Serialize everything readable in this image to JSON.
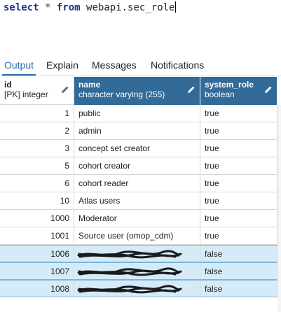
{
  "query": {
    "kw_select": "select",
    "star": "*",
    "kw_from": "from",
    "table": "webapi.sec_role"
  },
  "tabs": [
    {
      "label": "Output",
      "active": true
    },
    {
      "label": "Explain"
    },
    {
      "label": "Messages"
    },
    {
      "label": "Notifications"
    }
  ],
  "columns": [
    {
      "name": "id",
      "type": "[PK] integer"
    },
    {
      "name": "name",
      "type": "character varying (255)"
    },
    {
      "name": "system_role",
      "type": "boolean"
    }
  ],
  "rows": [
    {
      "id": "1",
      "name": "public",
      "system_role": "true"
    },
    {
      "id": "2",
      "name": "admin",
      "system_role": "true"
    },
    {
      "id": "3",
      "name": "concept set creator",
      "system_role": "true"
    },
    {
      "id": "5",
      "name": "cohort creator",
      "system_role": "true"
    },
    {
      "id": "6",
      "name": "cohort reader",
      "system_role": "true"
    },
    {
      "id": "10",
      "name": "Atlas users",
      "system_role": "true"
    },
    {
      "id": "1000",
      "name": "Moderator",
      "system_role": "true"
    },
    {
      "id": "1001",
      "name": "Source user (omop_cdm)",
      "system_role": "true"
    },
    {
      "id": "1006",
      "name": "",
      "system_role": "false",
      "redacted": true
    },
    {
      "id": "1007",
      "name": "",
      "system_role": "false",
      "redacted": true
    },
    {
      "id": "1008",
      "name": "",
      "system_role": "false",
      "redacted": true
    }
  ],
  "colors": {
    "header_blue": "#326a98",
    "selected_row": "#d6ebf8",
    "active_tab": "#2a6db0",
    "keyword": "#1f2d8f"
  }
}
